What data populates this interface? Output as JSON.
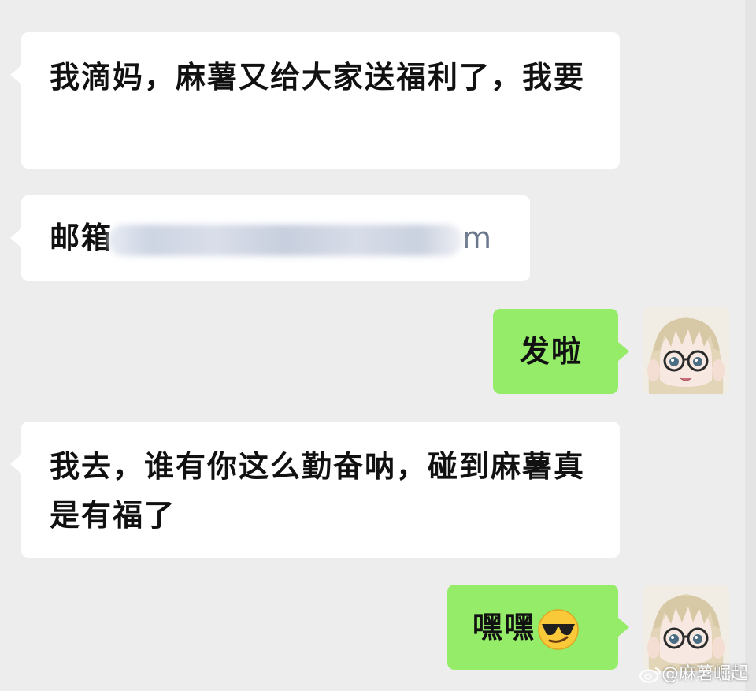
{
  "messages": [
    {
      "side": "left",
      "text": "我滴妈，麻薯又给大家送福利了，我要"
    },
    {
      "side": "left",
      "prefix": "邮箱",
      "tail": "m"
    },
    {
      "side": "right",
      "text": "发啦"
    },
    {
      "side": "left",
      "text": "我去，谁有你这么勤奋呐，碰到麻薯真是有福了"
    },
    {
      "side": "right",
      "text": "嘿嘿",
      "emoji": "sunglasses-smirk-emoji"
    }
  ],
  "avatar": {
    "icon": "anime-girl-glasses-avatar"
  },
  "watermark": {
    "text": "@麻薯崛起",
    "icon": "weibo-icon"
  },
  "colors": {
    "background": "#ededed",
    "incoming_bubble": "#ffffff",
    "outgoing_bubble": "#95ec69"
  }
}
